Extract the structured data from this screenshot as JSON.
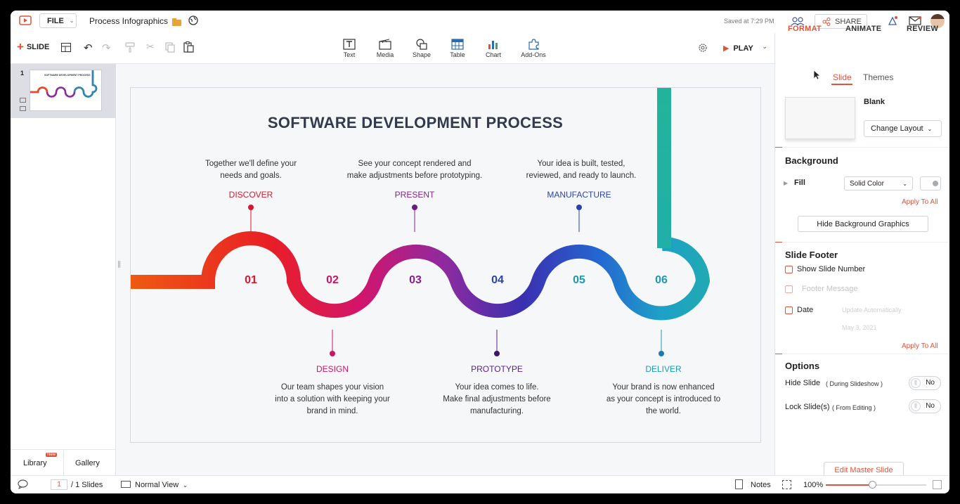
{
  "app": {
    "doc_title": "Process Infographics",
    "file_menu": "FILE",
    "saved_status": "Saved at 7:29 PM",
    "share_label": "SHARE"
  },
  "toolbar": {
    "add_slide": "SLIDE",
    "play": "PLAY",
    "tools": [
      {
        "label": "Text"
      },
      {
        "label": "Media"
      },
      {
        "label": "Shape"
      },
      {
        "label": "Table"
      },
      {
        "label": "Chart"
      },
      {
        "label": "Add-Ons"
      }
    ]
  },
  "tabs": {
    "format": "FORMAT",
    "animate": "ANIMATE",
    "review": "REVIEW"
  },
  "right": {
    "subtabs": {
      "slide": "Slide",
      "themes": "Themes"
    },
    "layout_name": "Blank",
    "change_layout": "Change Layout",
    "background": {
      "title": "Background",
      "fill_label": "Fill",
      "fill_value": "Solid Color",
      "apply_all": "Apply To All",
      "hide_graphics": "Hide Background Graphics"
    },
    "footer": {
      "title": "Slide Footer",
      "show_number": "Show Slide Number",
      "footer_message": "Footer Message",
      "date": "Date",
      "date_mode": "Update Automatically",
      "date_value": "May 3, 2021",
      "apply_all": "Apply To All"
    },
    "options": {
      "title": "Options",
      "hide_slide": "Hide Slide",
      "hide_slide_note": "( During Slideshow )",
      "hide_value": "No",
      "lock_slide": "Lock Slide(s)",
      "lock_slide_note": "( From Editing )",
      "lock_value": "No"
    },
    "edit_master": "Edit Master Slide"
  },
  "left": {
    "slide_number": "1",
    "thumb_title": "SOFTWARE DEVELOPMENT PROCESS",
    "library": "Library",
    "library_badge": "New",
    "gallery": "Gallery"
  },
  "status": {
    "page": "1",
    "total": "/ 1 Slides",
    "view": "Normal View",
    "notes": "Notes",
    "zoom": "100%"
  },
  "slide": {
    "title": "SOFTWARE DEVELOPMENT PROCESS",
    "steps": [
      {
        "num": "01",
        "name": "DISCOVER",
        "desc1": "Together we'll define your",
        "desc2": "needs and goals.",
        "desc3": "",
        "color": "#d8172f"
      },
      {
        "num": "02",
        "name": "DESIGN",
        "desc1": "Our team shapes your vision",
        "desc2": "into a solution with keeping your",
        "desc3": "brand in mind.",
        "color": "#cc1464"
      },
      {
        "num": "03",
        "name": "PRESENT",
        "desc1": "See your concept rendered and",
        "desc2": "make adjustments before prototyping.",
        "desc3": "",
        "color": "#8a1f8c"
      },
      {
        "num": "04",
        "name": "PROTOTYPE",
        "desc1": "Your idea comes to life.",
        "desc2": "Make final adjustments before",
        "desc3": "manufacturing.",
        "color": "#5a1e8c"
      },
      {
        "num": "05",
        "name": "MANUFACTURE",
        "desc1": "Your idea is built, tested,",
        "desc2": "reviewed, and ready to launch.",
        "desc3": "",
        "color": "#2a42b0"
      },
      {
        "num": "06",
        "name": "DELIVER",
        "desc1": "Your brand is now enhanced",
        "desc2": "as your concept is introduced to",
        "desc3": "the world.",
        "color": "#1b9bb0"
      }
    ]
  },
  "colors": {
    "accent": "#e0533a",
    "title": "#333a4d"
  }
}
